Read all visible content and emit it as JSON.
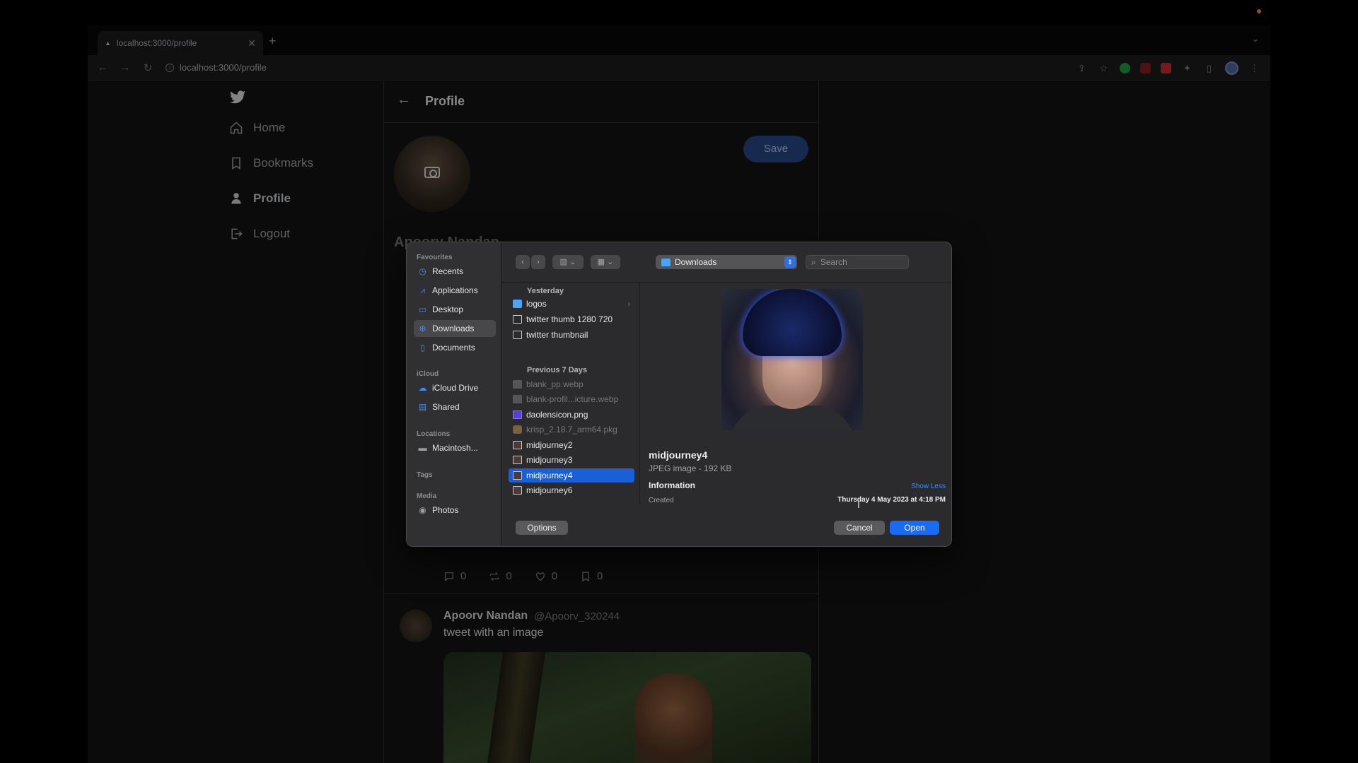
{
  "browser": {
    "tab_title": "localhost:3000/profile",
    "url": "localhost:3000/profile"
  },
  "sidebar": {
    "items": [
      {
        "label": "Home"
      },
      {
        "label": "Bookmarks"
      },
      {
        "label": "Profile"
      },
      {
        "label": "Logout"
      }
    ]
  },
  "main": {
    "title": "Profile",
    "save_label": "Save",
    "name_partial": "Apoorv Nandan",
    "stats": {
      "comments": "0",
      "retweets": "0",
      "likes": "0",
      "bookmarks": "0"
    },
    "tweet": {
      "name": "Apoorv Nandan",
      "handle": "@Apoorv_320244",
      "text": "tweet with an image"
    }
  },
  "dialog": {
    "sidebar": {
      "favourites_label": "Favourites",
      "favourites": [
        {
          "label": "Recents",
          "icon": "clock-icon"
        },
        {
          "label": "Applications",
          "icon": "applications-icon"
        },
        {
          "label": "Desktop",
          "icon": "desktop-icon"
        },
        {
          "label": "Downloads",
          "icon": "download-icon",
          "selected": true
        },
        {
          "label": "Documents",
          "icon": "document-icon"
        }
      ],
      "icloud_label": "iCloud",
      "icloud": [
        {
          "label": "iCloud Drive",
          "icon": "cloud-icon"
        },
        {
          "label": "Shared",
          "icon": "shared-folder-icon"
        }
      ],
      "locations_label": "Locations",
      "locations": [
        {
          "label": "Macintosh...",
          "icon": "disk-icon"
        }
      ],
      "tags_label": "Tags",
      "media_label": "Media",
      "media": [
        {
          "label": "Photos",
          "icon": "camera-icon"
        }
      ]
    },
    "location": "Downloads",
    "search_placeholder": "Search",
    "groups": [
      {
        "label": "Yesterday",
        "files": [
          {
            "name": "logos",
            "kind": "folder"
          },
          {
            "name": "twitter thumb 1280 720",
            "kind": "image"
          },
          {
            "name": "twitter thumbnail",
            "kind": "image"
          }
        ]
      },
      {
        "label": "Previous 7 Days",
        "files": [
          {
            "name": "blank_pp.webp",
            "kind": "dim"
          },
          {
            "name": "blank-profil...icture.webp",
            "kind": "dim"
          },
          {
            "name": "daolensicon.png",
            "kind": "png"
          },
          {
            "name": "krisp_2.18.7_arm64.pkg",
            "kind": "pkg"
          },
          {
            "name": "midjourney2",
            "kind": "jpg"
          },
          {
            "name": "midjourney3",
            "kind": "jpg"
          },
          {
            "name": "midjourney4",
            "kind": "jpg",
            "selected": true
          },
          {
            "name": "midjourney6",
            "kind": "jpg"
          }
        ]
      }
    ],
    "preview": {
      "name": "midjourney4",
      "kind": "JPEG image - 192 KB",
      "information_label": "Information",
      "show_less": "Show Less",
      "created_label": "Created",
      "created_value": "Thursday 4 May 2023 at 4:18 PM"
    },
    "options_label": "Options",
    "cancel_label": "Cancel",
    "open_label": "Open"
  }
}
